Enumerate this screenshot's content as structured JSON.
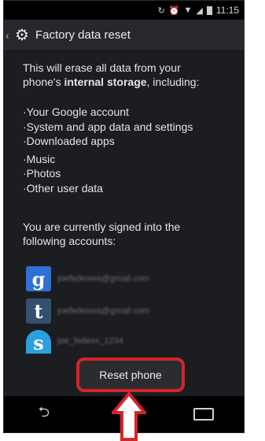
{
  "status_bar": {
    "time": "11:15"
  },
  "action_bar": {
    "title": "Factory data reset"
  },
  "intro": {
    "line1": "This will erase all data from your",
    "line2_prefix": "phone's ",
    "line2_bold": "internal storage",
    "line2_suffix": ", including:"
  },
  "bullets": [
    "·Your Google account",
    "·System and app data and settings",
    "·Downloaded apps",
    "·Music",
    "·Photos",
    "·Other user data"
  ],
  "signed_in_text": {
    "line1": "You are currently signed into the",
    "line2": "following accounts:"
  },
  "accounts": [
    {
      "letter": "g",
      "email": "joefedexwa@gmail.com",
      "color": "#2f6fd6"
    },
    {
      "letter": "t",
      "email": "joefedexwa@gmail.com",
      "color": "#34506f"
    },
    {
      "letter": "s",
      "email": "joe_fedexx_1234",
      "color": "#2aa0e0"
    }
  ],
  "reset_button": {
    "label": "Reset phone"
  },
  "colors": {
    "highlight": "#d8232a",
    "background": "#1b1d20"
  }
}
